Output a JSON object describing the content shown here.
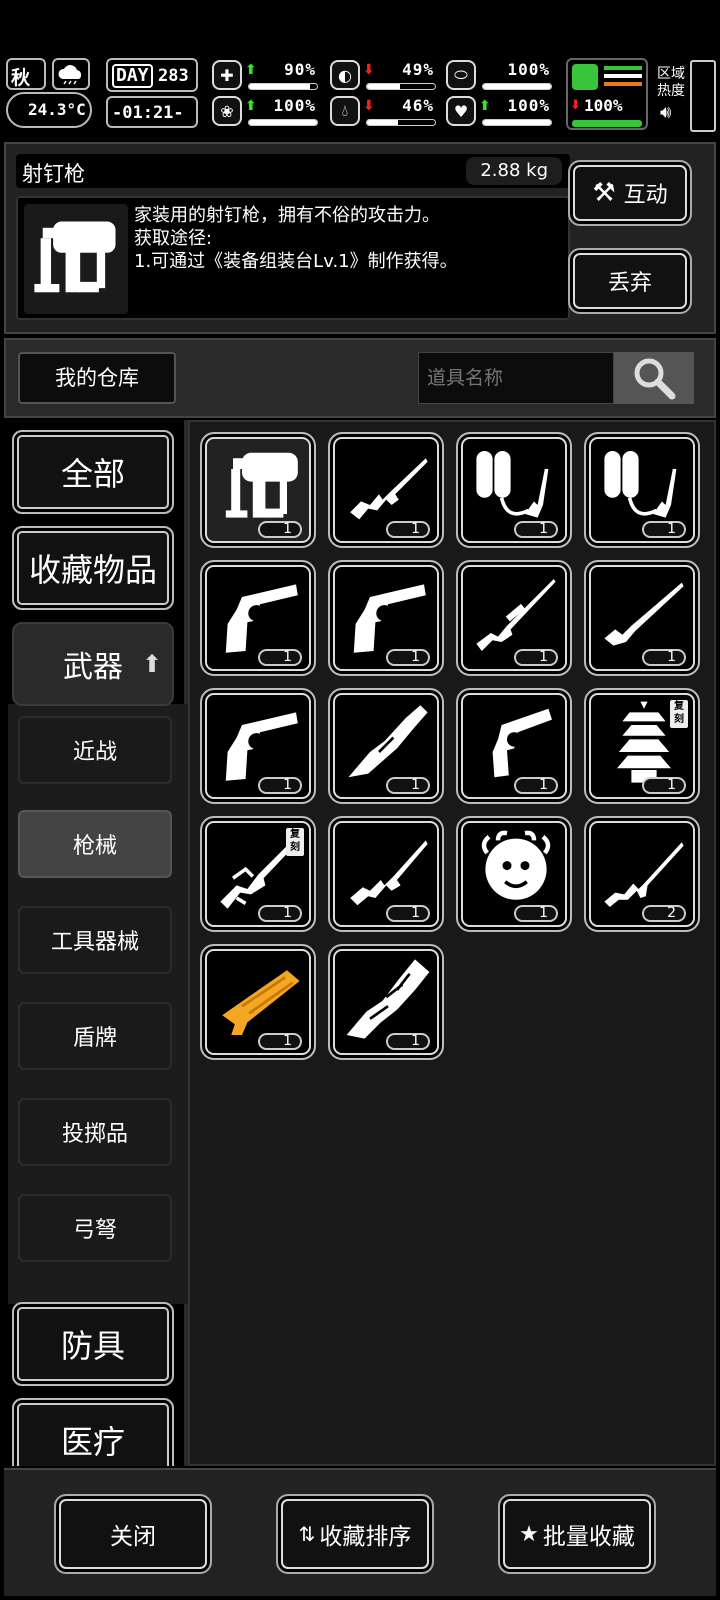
{
  "status": {
    "season": "秋",
    "temperature": "24.3°C",
    "day_label": "DAY",
    "day": "283",
    "time": "-01:21-",
    "stats": [
      {
        "name": "health",
        "icon": "medkit-icon",
        "trend": "up",
        "value": "90%"
      },
      {
        "name": "hunger",
        "icon": "stomach-icon",
        "trend": "down",
        "value": "49%"
      },
      {
        "name": "energy",
        "icon": "capsule-icon",
        "trend": "none",
        "value": "100%"
      },
      {
        "name": "mood",
        "icon": "brain-icon",
        "trend": "up",
        "value": "100%"
      },
      {
        "name": "thirst",
        "icon": "water-drop-icon",
        "trend": "down",
        "value": "46%"
      },
      {
        "name": "heart",
        "icon": "heart-icon",
        "trend": "up",
        "value": "100%"
      }
    ],
    "stamina": "100%",
    "region_heat_label": "区域热度"
  },
  "item": {
    "name": "射钉枪",
    "weight": "2.88 kg",
    "description": "家装用的射钉枪，拥有不俗的攻击力。\n获取途径:\n1.可通过《装备组装台Lv.1》制作获得。",
    "interact_label": "互动",
    "discard_label": "丢弃"
  },
  "warehouse": {
    "title": "我的仓库",
    "search_placeholder": "道具名称"
  },
  "categories": {
    "all": "全部",
    "favorites": "收藏物品",
    "weapons": "武器",
    "sub": [
      "近战",
      "枪械",
      "工具器械",
      "盾牌",
      "投掷品",
      "弓弩"
    ],
    "selected_sub": "枪械",
    "armor": "防具",
    "medical": "医疗"
  },
  "grid": [
    {
      "icon": "nail-gun-icon",
      "count": "1",
      "tag": ""
    },
    {
      "icon": "assault-rifle-icon",
      "count": "1",
      "tag": ""
    },
    {
      "icon": "flamethrower-icon",
      "count": "1",
      "tag": ""
    },
    {
      "icon": "flamethrower-icon",
      "count": "1",
      "tag": ""
    },
    {
      "icon": "revolver-icon",
      "count": "1",
      "tag": ""
    },
    {
      "icon": "revolver-icon",
      "count": "1",
      "tag": ""
    },
    {
      "icon": "sniper-rifle-icon",
      "count": "1",
      "tag": ""
    },
    {
      "icon": "hunting-rifle-icon",
      "count": "1",
      "tag": ""
    },
    {
      "icon": "revolver-icon",
      "count": "1",
      "tag": ""
    },
    {
      "icon": "dragon-cannon-icon",
      "count": "1",
      "tag": ""
    },
    {
      "icon": "ornate-revolver-icon",
      "count": "1",
      "tag": ""
    },
    {
      "icon": "pagoda-icon",
      "count": "1",
      "tag": "复刻"
    },
    {
      "icon": "dragon-rifle-icon",
      "count": "1",
      "tag": "复刻"
    },
    {
      "icon": "carbine-icon",
      "count": "1",
      "tag": ""
    },
    {
      "icon": "medusa-icon",
      "count": "1",
      "tag": ""
    },
    {
      "icon": "ak-rifle-icon",
      "count": "2",
      "tag": ""
    },
    {
      "icon": "golden-shotgun-icon",
      "count": "1",
      "tag": ""
    },
    {
      "icon": "tribal-cannon-icon",
      "count": "1",
      "tag": ""
    }
  ],
  "bottom": {
    "close": "关闭",
    "sort_favorites": "收藏排序",
    "batch_favorite": "批量收藏"
  }
}
